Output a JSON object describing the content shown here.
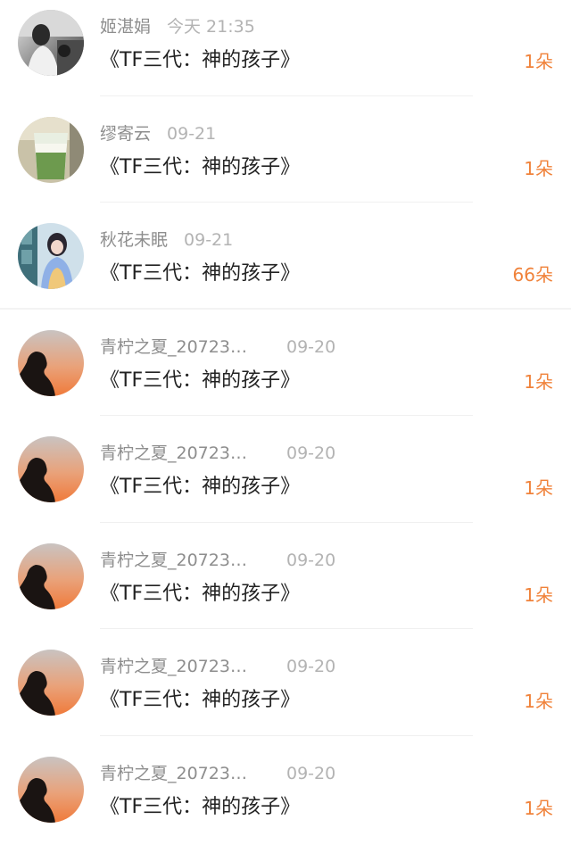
{
  "colors": {
    "count_orange": "#f0823a",
    "name_gray": "#8e8e8e",
    "time_gray": "#b3b3b3",
    "title_black": "#222222"
  },
  "rows": [
    {
      "avatar": "avatar-bw-photo-icon",
      "name": "姬湛娟",
      "time": "今天 21:35",
      "gift": "《TF三代：神的孩子》",
      "count": "1朵"
    },
    {
      "avatar": "avatar-matcha-drink-icon",
      "name": "缪寄云",
      "time": "09-21",
      "gift": "《TF三代：神的孩子》",
      "count": "1朵"
    },
    {
      "avatar": "avatar-girl-blue-icon",
      "name": "秋花未眠",
      "time": "09-21",
      "gift": "《TF三代：神的孩子》",
      "count": "66朵"
    },
    {
      "avatar": "avatar-sunset-silhouette-icon",
      "name": "青柠之夏_20723…",
      "time": "09-20",
      "gift": "《TF三代：神的孩子》",
      "count": "1朵"
    },
    {
      "avatar": "avatar-sunset-silhouette-icon",
      "name": "青柠之夏_20723…",
      "time": "09-20",
      "gift": "《TF三代：神的孩子》",
      "count": "1朵"
    },
    {
      "avatar": "avatar-sunset-silhouette-icon",
      "name": "青柠之夏_20723…",
      "time": "09-20",
      "gift": "《TF三代：神的孩子》",
      "count": "1朵"
    },
    {
      "avatar": "avatar-sunset-silhouette-icon",
      "name": "青柠之夏_20723…",
      "time": "09-20",
      "gift": "《TF三代：神的孩子》",
      "count": "1朵"
    },
    {
      "avatar": "avatar-sunset-silhouette-icon",
      "name": "青柠之夏_20723…",
      "time": "09-20",
      "gift": "《TF三代：神的孩子》",
      "count": "1朵"
    }
  ]
}
